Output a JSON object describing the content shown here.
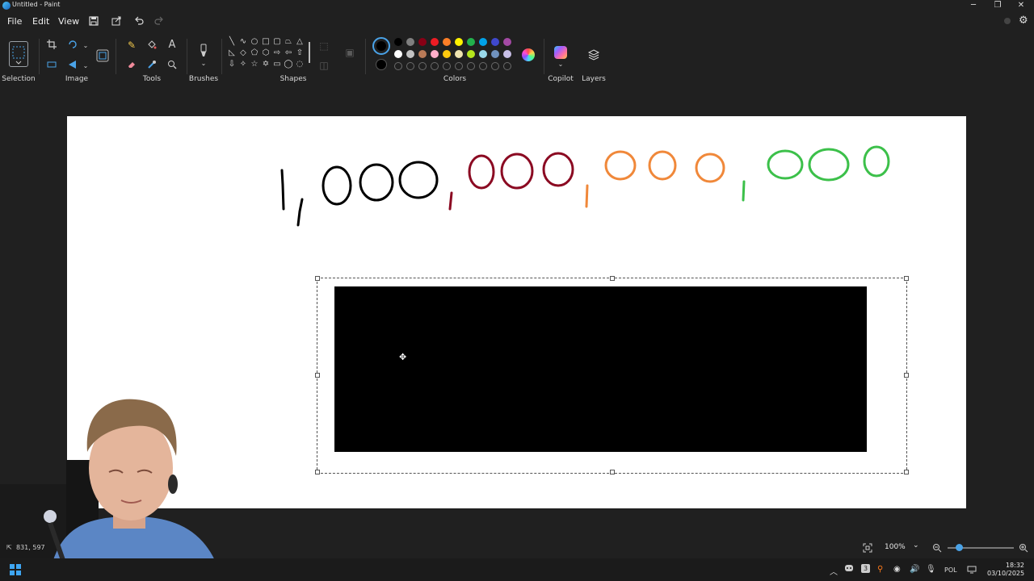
{
  "window": {
    "title": "Untitled - Paint",
    "minimize_glyph": "─",
    "restore_glyph": "❐",
    "close_glyph": "✕"
  },
  "menu": {
    "file": "File",
    "edit": "Edit",
    "view": "View"
  },
  "ribbon": {
    "groups": {
      "selection": "Selection",
      "image": "Image",
      "tools": "Tools",
      "brushes": "Brushes",
      "shapes": "Shapes",
      "colors": "Colors",
      "copilot": "Copilot",
      "layers": "Layers"
    },
    "palette_row1": [
      "#000000",
      "#7f7f7f",
      "#880015",
      "#ed1c24",
      "#ff7f27",
      "#fff200",
      "#22b14c",
      "#00a2e8",
      "#3f48cc",
      "#a349a4"
    ],
    "palette_row2": [
      "#ffffff",
      "#c3c3c3",
      "#b97a57",
      "#ffaec9",
      "#ffc90e",
      "#efe4b0",
      "#b5e61d",
      "#99d9ea",
      "#7092be",
      "#c8bfe7"
    ],
    "primary_color": "#000000",
    "secondary_color": "#000000"
  },
  "canvas": {
    "ink_colors": {
      "black": "#000000",
      "crimson": "#8b0a22",
      "orange": "#f0883a",
      "green": "#3cc04a"
    },
    "selection_fill": "#000000"
  },
  "status": {
    "cursor_position": "831, 597",
    "zoom_level": "100%"
  },
  "taskbar": {
    "language": "POL",
    "time": "18:32",
    "date": "03/10/2025",
    "badge_count": "3"
  }
}
